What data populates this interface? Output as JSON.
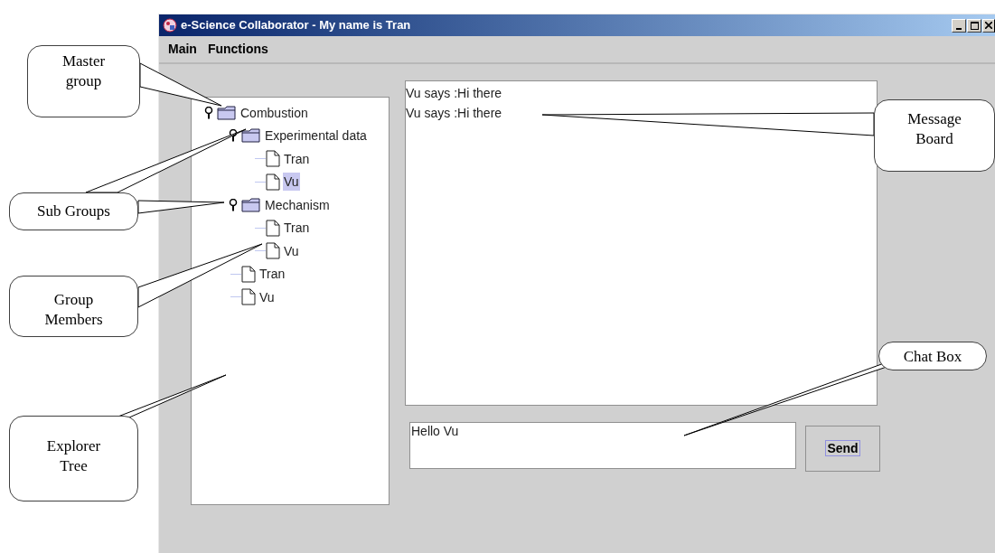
{
  "window": {
    "title": "e-Science Collaborator - My name is Tran"
  },
  "menu": [
    "Main",
    "Functions"
  ],
  "tree": [
    {
      "label": "Combustion",
      "kind": "folder",
      "expanded": true,
      "selected": false,
      "children": [
        {
          "label": "Experimental data",
          "kind": "folder",
          "expanded": true,
          "selected": false,
          "children": [
            {
              "label": "Tran",
              "kind": "file",
              "selected": false
            },
            {
              "label": "Vu",
              "kind": "file",
              "selected": true
            }
          ]
        },
        {
          "label": "Mechanism",
          "kind": "folder",
          "expanded": true,
          "selected": false,
          "children": [
            {
              "label": "Tran",
              "kind": "file",
              "selected": false
            },
            {
              "label": "Vu",
              "kind": "file",
              "selected": false
            }
          ]
        },
        {
          "label": "Tran",
          "kind": "file",
          "selected": false
        },
        {
          "label": "Vu",
          "kind": "file",
          "selected": false
        }
      ]
    }
  ],
  "message_board": [
    "Vu says :Hi there",
    "Vu says :Hi there"
  ],
  "chat_box": {
    "value": "Hello Vu"
  },
  "send_button": "Send",
  "callouts": [
    {
      "text": "Master group"
    },
    {
      "text": "Sub Groups"
    },
    {
      "text": "Group Members"
    },
    {
      "text": "Explorer Tree"
    },
    {
      "text": "Message Board"
    },
    {
      "text": "Chat Box"
    }
  ]
}
